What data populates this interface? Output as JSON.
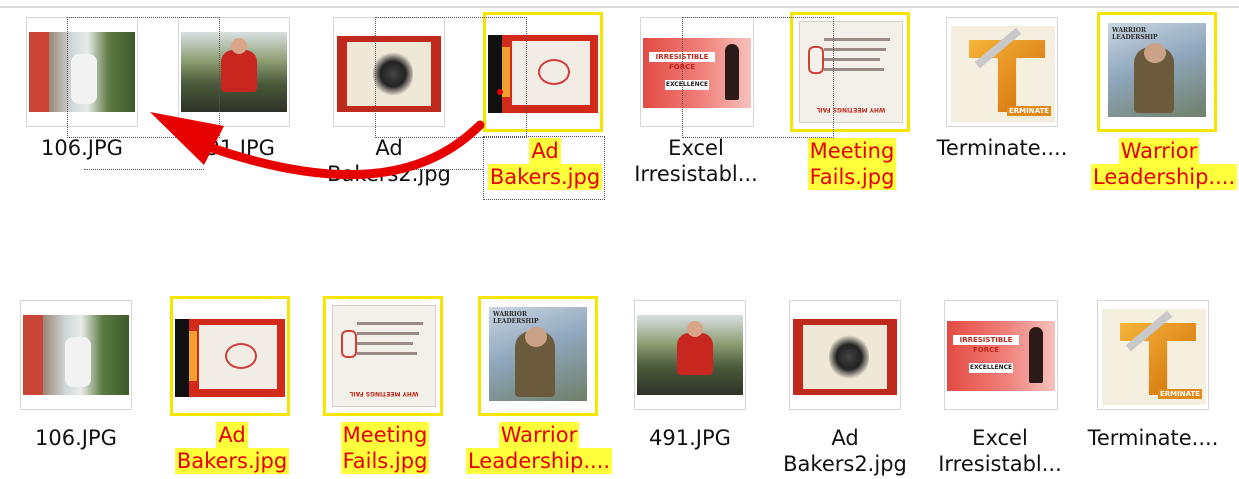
{
  "colors": {
    "selection_border": "#f5e600",
    "selection_fill": "#ffff3c",
    "selected_text": "#e60000",
    "arrow": "#e60000"
  },
  "top_row": [
    {
      "line1": "106.JPG",
      "line2": "",
      "selected": false,
      "icon": "photo-thumbnail"
    },
    {
      "line1": "491.JPG",
      "line2": "",
      "selected": false,
      "icon": "photo-thumbnail"
    },
    {
      "line1": "Ad",
      "line2": "Bakers2.jpg",
      "selected": false,
      "icon": "poster-thumbnail"
    },
    {
      "line1": "Ad",
      "line2": "Bakers.jpg",
      "selected": true,
      "icon": "poster-thumbnail"
    },
    {
      "line1": "Excel",
      "line2": "Irresistabl...",
      "selected": false,
      "icon": "slide-thumbnail"
    },
    {
      "line1": "Meeting",
      "line2": "Fails.jpg",
      "selected": true,
      "icon": "slide-thumbnail"
    },
    {
      "line1": "Terminate....",
      "line2": "",
      "selected": false,
      "icon": "graphic-thumbnail"
    },
    {
      "line1": "Warrior",
      "line2": "Leadership....",
      "selected": true,
      "icon": "poster-thumbnail"
    }
  ],
  "bottom_row": [
    {
      "line1": "106.JPG",
      "line2": "",
      "selected": false,
      "icon": "photo-thumbnail"
    },
    {
      "line1": "Ad",
      "line2": "Bakers.jpg",
      "selected": true,
      "icon": "poster-thumbnail"
    },
    {
      "line1": "Meeting",
      "line2": "Fails.jpg",
      "selected": true,
      "icon": "slide-thumbnail"
    },
    {
      "line1": "Warrior",
      "line2": "Leadership....",
      "selected": true,
      "icon": "poster-thumbnail"
    },
    {
      "line1": "491.JPG",
      "line2": "",
      "selected": false,
      "icon": "photo-thumbnail"
    },
    {
      "line1": "Ad",
      "line2": "Bakers2.jpg",
      "selected": false,
      "icon": "poster-thumbnail"
    },
    {
      "line1": "Excel",
      "line2": "Irresistabl...",
      "selected": false,
      "icon": "slide-thumbnail"
    },
    {
      "line1": "Terminate....",
      "line2": "",
      "selected": false,
      "icon": "graphic-thumbnail"
    }
  ],
  "thumb_text": {
    "excel_banner": "IRRESISTIBLE FORCE",
    "excel_sub": "EXCELLENCE",
    "meeting_footer": "WHY MEETINGS FAIL",
    "terminate_tag": "ERMINATE",
    "warrior_header": "WARRIOR LEADERSHIP"
  }
}
